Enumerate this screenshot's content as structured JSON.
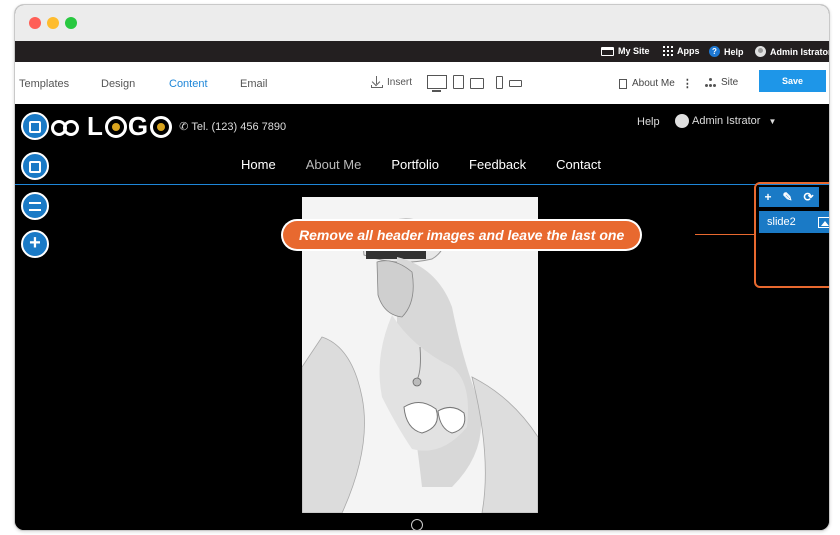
{
  "admin_bar": {
    "my_site": "My Site",
    "apps": "Apps",
    "help": "Help",
    "user": "Admin Istrator"
  },
  "toolbar": {
    "tabs": [
      "Templates",
      "Design",
      "Content",
      "Email"
    ],
    "active_tab": "Content",
    "insert": "Insert",
    "page": "About Me",
    "site": "Site",
    "save": "Save"
  },
  "site_header": {
    "logo_text_1": "L",
    "logo_text_2": "G",
    "phone": "Tel. (123) 456 7890",
    "help": "Help",
    "user": "Admin Istrator"
  },
  "nav": {
    "items": [
      "Home",
      "About Me",
      "Portfolio",
      "Feedback",
      "Contact"
    ]
  },
  "slides_panel": {
    "slide": "slide2"
  },
  "callout": {
    "text": "Remove all header images and leave the last one"
  },
  "colors": {
    "accent": "#1e86d8",
    "callout": "#e8692f",
    "save_button": "#1e96e8"
  }
}
